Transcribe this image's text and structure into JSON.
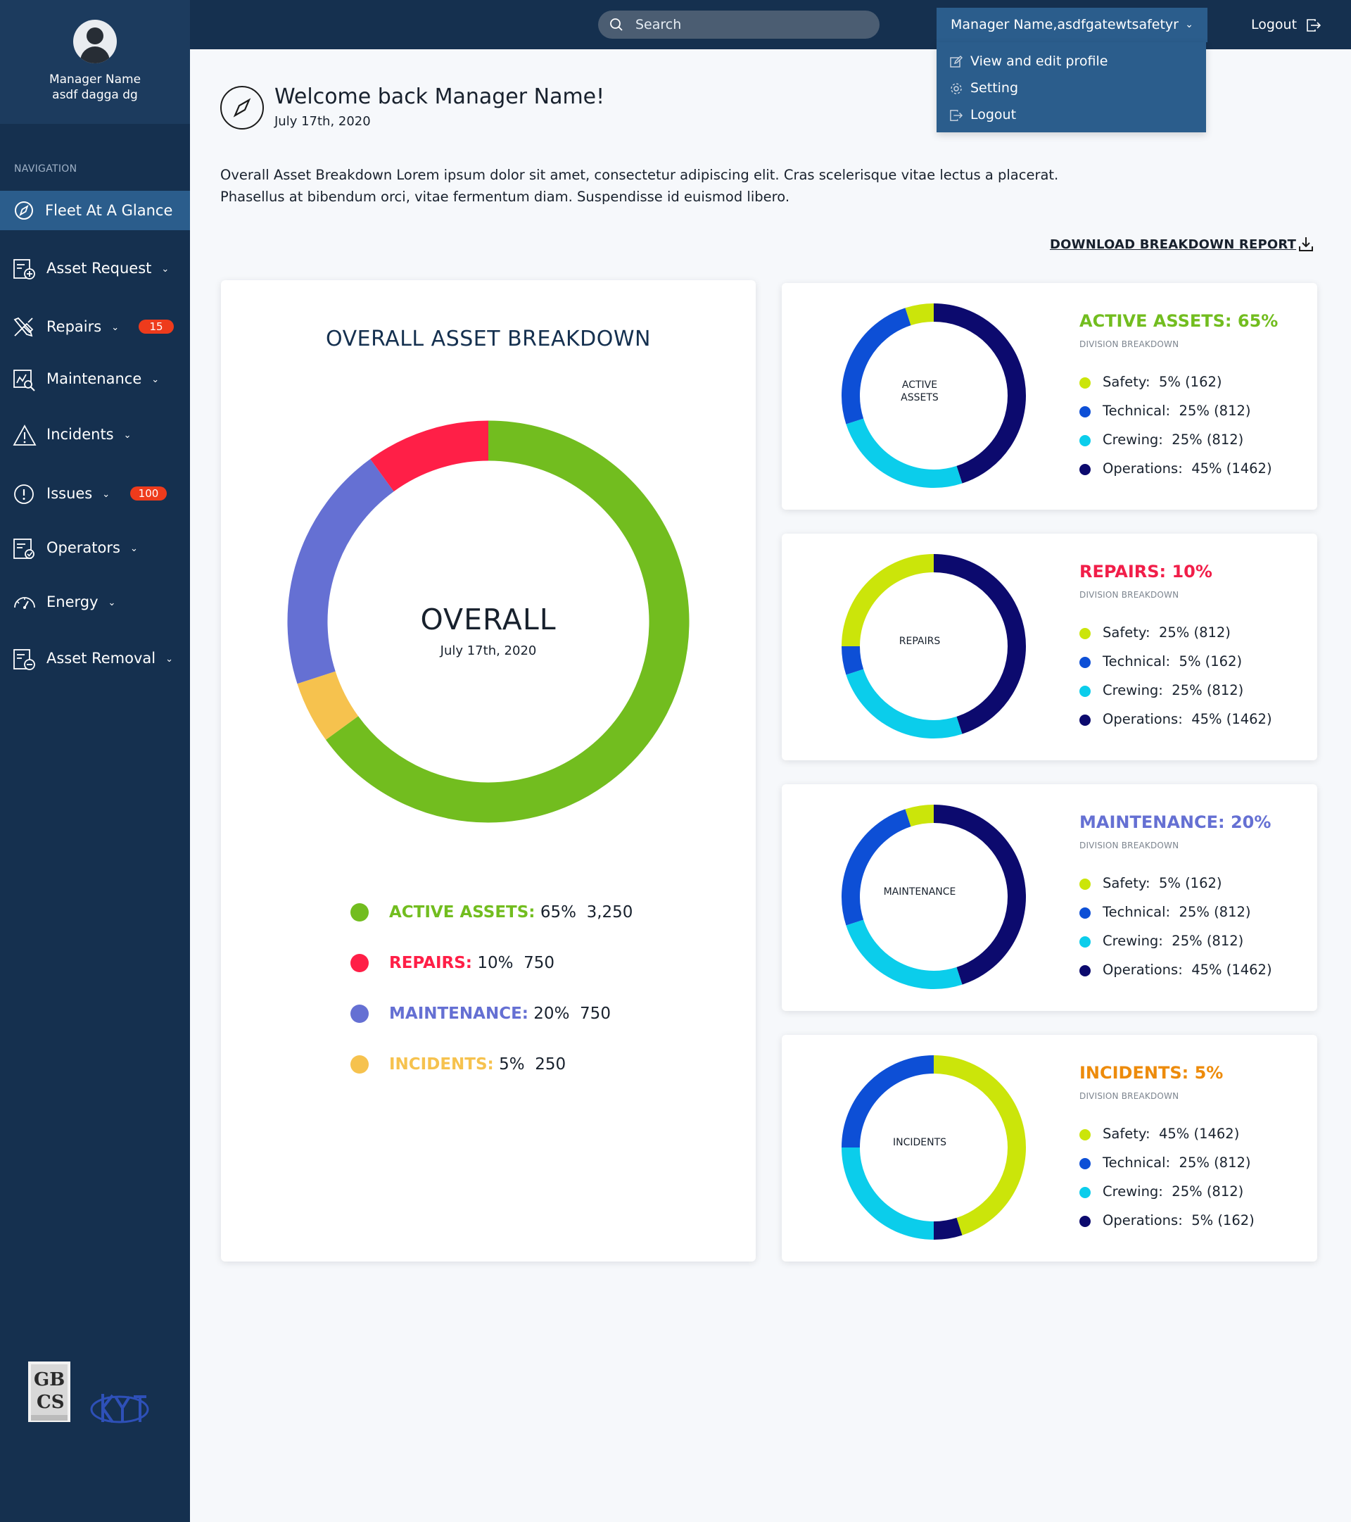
{
  "profile": {
    "name": "Manager Name",
    "subtitle": "asdf dagga dg"
  },
  "nav": {
    "label": "NAVIGATION",
    "items": [
      {
        "label": "Fleet At A Glance",
        "icon": "compass-icon",
        "active": true
      },
      {
        "label": "Asset Request",
        "icon": "asset-request-icon"
      },
      {
        "label": "Repairs",
        "icon": "tools-icon",
        "badge": "15"
      },
      {
        "label": "Maintenance",
        "icon": "maintenance-icon"
      },
      {
        "label": "Incidents",
        "icon": "warning-icon"
      },
      {
        "label": "Issues",
        "icon": "exclamation-icon",
        "badge": "100"
      },
      {
        "label": "Operators",
        "icon": "operators-icon"
      },
      {
        "label": "Energy",
        "icon": "gauge-icon"
      },
      {
        "label": "Asset Removal",
        "icon": "asset-removal-icon"
      }
    ]
  },
  "topbar": {
    "search_placeholder": "Search",
    "user_menu": "Manager Name,asdfgatewtsafetyr",
    "logout": "Logout",
    "dropdown": [
      "View and edit profile",
      "Setting",
      "Logout"
    ]
  },
  "header": {
    "title": "Welcome back Manager Name!",
    "date": "July 17th, 2020",
    "intro_line1": "Overall Asset Breakdown Lorem ipsum dolor sit amet, consectetur adipiscing elit. Cras scelerisque vitae lectus a placerat.",
    "intro_line2": "Phasellus at bibendum orci, vitae fermentum diam. Suspendisse id euismod libero.",
    "download": "DOWNLOAD BREAKDOWN REPORT"
  },
  "colors": {
    "active": "#72bd1f",
    "repairs": "#ff1f47",
    "maintenance": "#6570d3",
    "incidents": "#f6c24e",
    "safety": "#cbe50a",
    "technical": "#0d4fd6",
    "crewing": "#0bcdeb",
    "operations": "#0c0a6e",
    "title_active": "#72bd1f",
    "title_repairs": "#f11e49",
    "title_maintenance": "#6570d3",
    "title_incidents": "#ed8b0b"
  },
  "overall": {
    "title": "OVERALL ASSET BREAKDOWN",
    "center": "OVERALL",
    "date": "July 17th, 2020",
    "legend": [
      {
        "cat": "ACTIVE ASSETS:",
        "pct": "65%",
        "count": "3,250",
        "color": "#72bd1f"
      },
      {
        "cat": "REPAIRS:",
        "pct": "10%",
        "count": "750",
        "color": "#ff1f47"
      },
      {
        "cat": "MAINTENANCE:",
        "pct": "20%",
        "count": "750",
        "color": "#6570d3"
      },
      {
        "cat": "INCIDENTS:",
        "pct": "5%",
        "count": "250",
        "color": "#f6c24e"
      }
    ]
  },
  "chart_data": [
    {
      "type": "pie",
      "title": "OVERALL ASSET BREAKDOWN",
      "categories": [
        "Active Assets",
        "Incidents",
        "Maintenance",
        "Repairs"
      ],
      "values": [
        65,
        5,
        20,
        10
      ],
      "colors": [
        "#72bd1f",
        "#f6c24e",
        "#6570d3",
        "#ff1f47"
      ]
    },
    {
      "type": "pie",
      "title": "ACTIVE ASSETS: 65%",
      "center": "ACTIVE ASSETS",
      "categories": [
        "Operations",
        "Crewing",
        "Technical",
        "Safety"
      ],
      "values": [
        45,
        25,
        25,
        5
      ],
      "colors": [
        "#0c0a6e",
        "#0bcdeb",
        "#0d4fd6",
        "#cbe50a"
      ]
    },
    {
      "type": "pie",
      "title": "REPAIRS: 10%",
      "center": "REPAIRS",
      "categories": [
        "Operations",
        "Crewing",
        "Technical",
        "Safety"
      ],
      "values": [
        45,
        25,
        5,
        25
      ],
      "colors": [
        "#0c0a6e",
        "#0bcdeb",
        "#0d4fd6",
        "#cbe50a"
      ]
    },
    {
      "type": "pie",
      "title": "MAINTENANCE: 20%",
      "center": "MAINTENANCE",
      "categories": [
        "Operations",
        "Crewing",
        "Technical",
        "Safety"
      ],
      "values": [
        45,
        25,
        25,
        5
      ],
      "colors": [
        "#0c0a6e",
        "#0bcdeb",
        "#0d4fd6",
        "#cbe50a"
      ]
    },
    {
      "type": "pie",
      "title": "INCIDENTS: 5%",
      "center": "INCIDENTS",
      "categories": [
        "Safety",
        "Operations",
        "Crewing",
        "Technical"
      ],
      "values": [
        45,
        5,
        25,
        25
      ],
      "colors": [
        "#cbe50a",
        "#0c0a6e",
        "#0bcdeb",
        "#0d4fd6"
      ]
    }
  ],
  "divisions": [
    {
      "title": "ACTIVE ASSETS: 65%",
      "title_color": "#72bd1f",
      "sub": "DIVISION BREAKDOWN",
      "center": "ACTIVE ASSETS",
      "rows": [
        {
          "label": "Safety:",
          "value": "5% (162)",
          "color": "#cbe50a"
        },
        {
          "label": "Technical:",
          "value": "25% (812)",
          "color": "#0d4fd6"
        },
        {
          "label": "Crewing:",
          "value": "25% (812)",
          "color": "#0bcdeb"
        },
        {
          "label": "Operations:",
          "value": "45% (1462)",
          "color": "#0c0a6e"
        }
      ]
    },
    {
      "title": "REPAIRS: 10%",
      "title_color": "#f11e49",
      "sub": "DIVISION BREAKDOWN",
      "center": "REPAIRS",
      "rows": [
        {
          "label": "Safety:",
          "value": "25% (812)",
          "color": "#cbe50a"
        },
        {
          "label": "Technical:",
          "value": "5% (162)",
          "color": "#0d4fd6"
        },
        {
          "label": "Crewing:",
          "value": "25% (812)",
          "color": "#0bcdeb"
        },
        {
          "label": "Operations:",
          "value": "45% (1462)",
          "color": "#0c0a6e"
        }
      ]
    },
    {
      "title": "MAINTENANCE: 20%",
      "title_color": "#6570d3",
      "sub": "DIVISION BREAKDOWN",
      "center": "MAINTENANCE",
      "rows": [
        {
          "label": "Safety:",
          "value": "5% (162)",
          "color": "#cbe50a"
        },
        {
          "label": "Technical:",
          "value": "25% (812)",
          "color": "#0d4fd6"
        },
        {
          "label": "Crewing:",
          "value": "25% (812)",
          "color": "#0bcdeb"
        },
        {
          "label": "Operations:",
          "value": "45% (1462)",
          "color": "#0c0a6e"
        }
      ]
    },
    {
      "title": "INCIDENTS: 5%",
      "title_color": "#ed8b0b",
      "sub": "DIVISION BREAKDOWN",
      "center": "INCIDENTS",
      "rows": [
        {
          "label": "Safety:",
          "value": "45% (1462)",
          "color": "#cbe50a"
        },
        {
          "label": "Technical:",
          "value": "25% (812)",
          "color": "#0d4fd6"
        },
        {
          "label": "Crewing:",
          "value": "25% (812)",
          "color": "#0bcdeb"
        },
        {
          "label": "Operations:",
          "value": "5% (162)",
          "color": "#0c0a6e"
        }
      ]
    }
  ]
}
